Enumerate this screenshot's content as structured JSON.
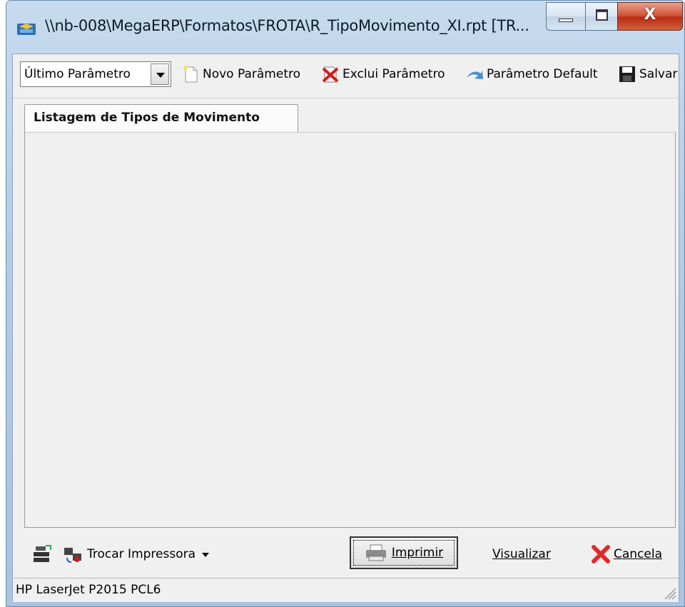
{
  "window": {
    "title": "\\\\nb-008\\MegaERP\\Formatos\\FROTA\\R_TipoMovimento_XI.rpt [TR...",
    "buttons": {
      "minimize": "minimize",
      "maximize": "maximize",
      "close": "X"
    }
  },
  "toolbar": {
    "param_select_value": "Último Parâmetro",
    "new_param": "Novo Parâmetro",
    "delete_param": "Exclui Parâmetro",
    "default_param": "Parâmetro Default",
    "save": "Salvar"
  },
  "tabs": [
    {
      "label": "Listagem de Tipos de Movimento",
      "active": true
    }
  ],
  "footer": {
    "change_printer": "Trocar Impressora",
    "print": "Imprimir",
    "preview": "Visualizar",
    "cancel": "Cancela"
  },
  "status": {
    "printer": "HP LaserJet P2015 PCL6"
  },
  "icons": [
    "app-icon",
    "document-new-icon",
    "delete-x-icon",
    "default-arrow-icon",
    "floppy-save-icon",
    "printer-settings-icon",
    "printer-swap-icon",
    "dropdown-arrow-icon",
    "printer-icon",
    "red-x-icon",
    "resize-grip-icon"
  ],
  "colors": {
    "titlebar": "#b4cce6",
    "close_button": "#c7391b",
    "client_bg": "#f0f0f0"
  }
}
